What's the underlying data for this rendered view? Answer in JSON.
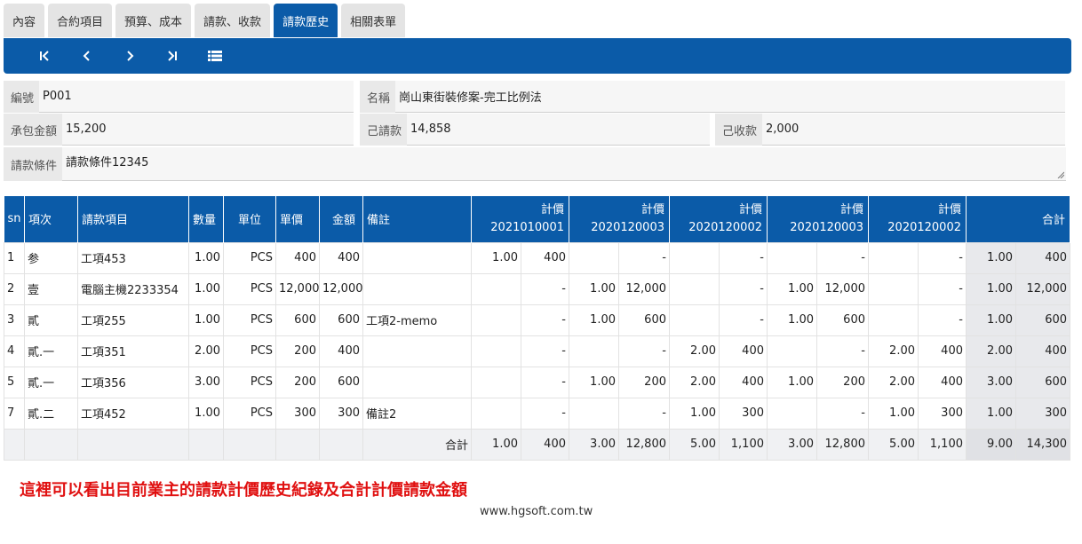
{
  "tabs": [
    {
      "label": "內容",
      "active": false
    },
    {
      "label": "合約項目",
      "active": false
    },
    {
      "label": "預算、成本",
      "active": false
    },
    {
      "label": "請款、收款",
      "active": false
    },
    {
      "label": "請款歷史",
      "active": true
    },
    {
      "label": "相關表單",
      "active": false
    }
  ],
  "toolbar": {
    "buttons": [
      "first-page-icon",
      "previous-icon",
      "next-icon",
      "last-page-icon",
      "list-icon"
    ],
    "color": "#0b5ba8"
  },
  "form": {
    "code_label": "編號",
    "code_value": "P001",
    "name_label": "名稱",
    "name_value": "崗山東街裝修案-完工比例法",
    "contract_label": "承包金額",
    "contract_value": "15,200",
    "billed_label": "己請款",
    "billed_value": "14,858",
    "received_label": "己收款",
    "received_value": "2,000",
    "terms_label": "請款條件",
    "terms_value": "請款條件12345"
  },
  "table": {
    "headers": {
      "sn": "sn",
      "seq": "項次",
      "item": "請款項目",
      "qty": "數量",
      "unit": "單位",
      "price": "單價",
      "amount": "金額",
      "memo": "備註"
    },
    "price_groups": [
      {
        "label": "計價",
        "code": "2021010001"
      },
      {
        "label": "計價",
        "code": "2020120003"
      },
      {
        "label": "計價",
        "code": "2020120002"
      },
      {
        "label": "計價",
        "code": "2020120003"
      },
      {
        "label": "計價",
        "code": "2020120002"
      }
    ],
    "total_header": "合計",
    "rows": [
      {
        "sn": "1",
        "seq": "参",
        "item": "工項453",
        "qty": "1.00",
        "unit": "PCS",
        "price": "400",
        "amount": "400",
        "memo": "",
        "groups": [
          [
            "1.00",
            "400"
          ],
          [
            "",
            "-"
          ],
          [
            "",
            "-"
          ],
          [
            "",
            "-"
          ],
          [
            "",
            "-"
          ]
        ],
        "total": [
          "1.00",
          "400"
        ]
      },
      {
        "sn": "2",
        "seq": "壹",
        "item": "電腦主機2233354",
        "qty": "1.00",
        "unit": "PCS",
        "price": "12,000",
        "amount": "12,000",
        "memo": "",
        "groups": [
          [
            "",
            "-"
          ],
          [
            "1.00",
            "12,000"
          ],
          [
            "",
            "-"
          ],
          [
            "1.00",
            "12,000"
          ],
          [
            "",
            "-"
          ]
        ],
        "total": [
          "1.00",
          "12,000"
        ]
      },
      {
        "sn": "3",
        "seq": "貳",
        "item": "工項255",
        "qty": "1.00",
        "unit": "PCS",
        "price": "600",
        "amount": "600",
        "memo": "工項2-memo",
        "groups": [
          [
            "",
            "-"
          ],
          [
            "1.00",
            "600"
          ],
          [
            "",
            "-"
          ],
          [
            "1.00",
            "600"
          ],
          [
            "",
            "-"
          ]
        ],
        "total": [
          "1.00",
          "600"
        ]
      },
      {
        "sn": "4",
        "seq": "貳.一",
        "item": "工項351",
        "qty": "2.00",
        "unit": "PCS",
        "price": "200",
        "amount": "400",
        "memo": "",
        "groups": [
          [
            "",
            "-"
          ],
          [
            "",
            "-"
          ],
          [
            "2.00",
            "400"
          ],
          [
            "",
            "-"
          ],
          [
            "2.00",
            "400"
          ]
        ],
        "total": [
          "2.00",
          "400"
        ]
      },
      {
        "sn": "5",
        "seq": "貳.一",
        "item": "工項356",
        "qty": "3.00",
        "unit": "PCS",
        "price": "200",
        "amount": "600",
        "memo": "",
        "groups": [
          [
            "",
            "-"
          ],
          [
            "1.00",
            "200"
          ],
          [
            "2.00",
            "400"
          ],
          [
            "1.00",
            "200"
          ],
          [
            "2.00",
            "400"
          ]
        ],
        "total": [
          "3.00",
          "600"
        ]
      },
      {
        "sn": "7",
        "seq": "貳.二",
        "item": "工項452",
        "qty": "1.00",
        "unit": "PCS",
        "price": "300",
        "amount": "300",
        "memo": "備註2",
        "groups": [
          [
            "",
            "-"
          ],
          [
            "",
            "-"
          ],
          [
            "1.00",
            "300"
          ],
          [
            "",
            "-"
          ],
          [
            "1.00",
            "300"
          ]
        ],
        "total": [
          "1.00",
          "300"
        ]
      }
    ],
    "sum_label": "合計",
    "sum_groups": [
      [
        "1.00",
        "400"
      ],
      [
        "3.00",
        "12,800"
      ],
      [
        "5.00",
        "1,100"
      ],
      [
        "3.00",
        "12,800"
      ],
      [
        "5.00",
        "1,100"
      ]
    ],
    "sum_total": [
      "9.00",
      "14,300"
    ]
  },
  "note": "這裡可以看出目前業主的請款計價歷史紀錄及合計計價請款金額",
  "website": "www.hgsoft.com.tw",
  "colors": {
    "header_blue": "#0b5ba8",
    "note_red": "#e01010"
  }
}
